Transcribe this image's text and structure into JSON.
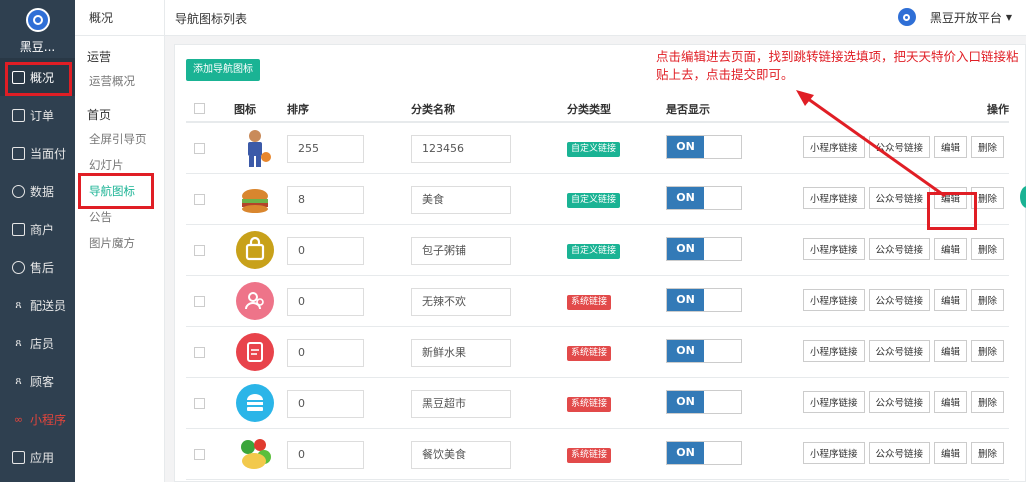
{
  "sidebar": {
    "brand": "黑豆...",
    "items": [
      {
        "label": "概况",
        "icon": "dashboard-icon"
      },
      {
        "label": "订单",
        "icon": "order-icon"
      },
      {
        "label": "当面付",
        "icon": "pay-icon"
      },
      {
        "label": "数据",
        "icon": "data-icon"
      },
      {
        "label": "商户",
        "icon": "shop-icon"
      },
      {
        "label": "售后",
        "icon": "aftersale-icon"
      },
      {
        "label": "配送员",
        "icon": "courier-icon"
      },
      {
        "label": "店员",
        "icon": "clerk-icon"
      },
      {
        "label": "顾客",
        "icon": "customer-icon"
      },
      {
        "label": "小程序",
        "icon": "miniapp-icon"
      },
      {
        "label": "应用",
        "icon": "apps-icon"
      }
    ]
  },
  "subnav": {
    "title": "概况",
    "group1": "运营",
    "group1_items": [
      "运营概况"
    ],
    "group2": "首页",
    "group2_items": [
      "全屏引导页",
      "幻灯片",
      "导航图标",
      "公告",
      "图片魔方"
    ]
  },
  "header": {
    "page_title": "导航图标列表",
    "platform": "黑豆开放平台"
  },
  "toolbar": {
    "add_label": "添加导航图标"
  },
  "table": {
    "headers": {
      "icon": "图标",
      "sort": "排序",
      "name": "分类名称",
      "type": "分类类型",
      "show": "是否显示",
      "ops": "操作"
    },
    "rows": [
      {
        "sort": "255",
        "name": "123456",
        "type": "自定义链接",
        "show": "ON"
      },
      {
        "sort": "8",
        "name": "美食",
        "type": "自定义链接",
        "show": "ON"
      },
      {
        "sort": "0",
        "name": "包子粥铺",
        "type": "自定义链接",
        "show": "ON"
      },
      {
        "sort": "0",
        "name": "无辣不欢",
        "type": "系统链接",
        "show": "ON"
      },
      {
        "sort": "0",
        "name": "新鲜水果",
        "type": "系统链接",
        "show": "ON"
      },
      {
        "sort": "0",
        "name": "黑豆超市",
        "type": "系统链接",
        "show": "ON"
      },
      {
        "sort": "0",
        "name": "餐饮美食",
        "type": "系统链接",
        "show": "ON"
      }
    ],
    "ops": {
      "mini": "小程序链接",
      "wechat": "公众号链接",
      "edit": "编辑",
      "delete": "删除"
    }
  },
  "annotation": "点击编辑进去页面，找到跳转链接选填项，把天天特价入口链接粘贴上去，点击提交即可。",
  "colors": {
    "accent": "#1ab394",
    "sidebar": "#2f4050",
    "annotation": "#e01e25",
    "toggle": "#337ab7"
  }
}
